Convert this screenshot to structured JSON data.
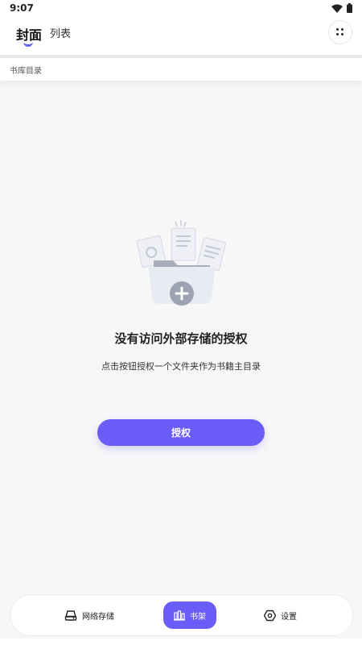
{
  "status": {
    "time": "9:07"
  },
  "header": {
    "tabs": [
      "封面",
      "列表"
    ]
  },
  "breadcrumb": "书库目录",
  "empty_state": {
    "title": "没有访问外部存储的授权",
    "description": "点击按钮授权一个文件夹作为书籍主目录",
    "button_label": "授权"
  },
  "bottom_nav": {
    "items": [
      {
        "label": "网络存储",
        "icon": "cloud-drive-icon",
        "active": false
      },
      {
        "label": "书架",
        "icon": "bookshelf-icon",
        "active": true
      },
      {
        "label": "设置",
        "icon": "gear-icon",
        "active": false
      }
    ]
  },
  "colors": {
    "accent": "#6a5cf6",
    "indicator": "#5b63f0",
    "background": "#f7f7f8"
  }
}
